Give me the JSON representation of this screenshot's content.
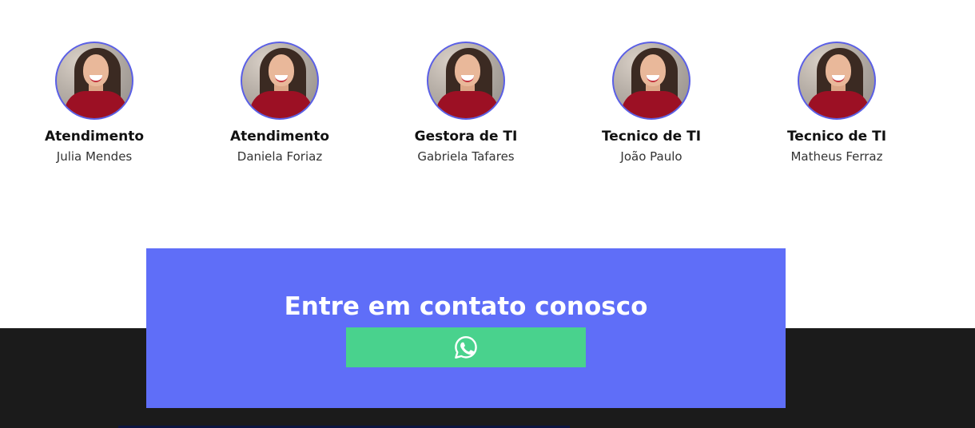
{
  "team": {
    "members": [
      {
        "role": "Atendimento",
        "name": "Julia Mendes"
      },
      {
        "role": "Atendimento",
        "name": "Daniela Foriaz"
      },
      {
        "role": "Gestora de TI",
        "name": "Gabriela Tafares"
      },
      {
        "role": "Tecnico de TI",
        "name": "João Paulo"
      },
      {
        "role": "Tecnico de TI",
        "name": "Matheus Ferraz"
      }
    ]
  },
  "contact": {
    "title": "Entre em contato conosco",
    "button_icon": "whatsapp-icon",
    "background_color": "#5f6ef8",
    "button_color": "#49d28d"
  },
  "footer": {
    "background_color": "#1b1b1b"
  }
}
